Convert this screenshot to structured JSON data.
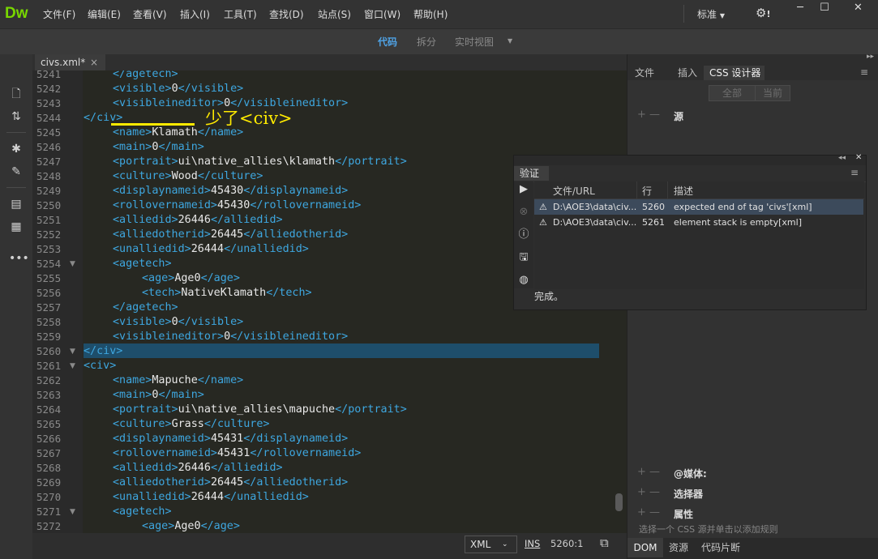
{
  "app": {
    "logo": "Dw"
  },
  "menu": [
    "文件(F)",
    "编辑(E)",
    "查看(V)",
    "插入(I)",
    "工具(T)",
    "查找(D)",
    "站点(S)",
    "窗口(W)",
    "帮助(H)"
  ],
  "workspace_label": "标准",
  "view_tabs": {
    "code": "代码",
    "split": "拆分",
    "live": "实时视图"
  },
  "doc_tab": {
    "label": "civs.xml*",
    "close": "×"
  },
  "line_numbers": [
    "5241",
    "5242",
    "5243",
    "5244",
    "5245",
    "5246",
    "5247",
    "5248",
    "5249",
    "5250",
    "5251",
    "5252",
    "5253",
    "5254",
    "5255",
    "5256",
    "5257",
    "5258",
    "5259",
    "5260",
    "5261",
    "5262",
    "5263",
    "5264",
    "5265",
    "5266",
    "5267",
    "5268",
    "5269",
    "5270",
    "5271",
    "5272"
  ],
  "code_lines": [
    {
      "indent": 2,
      "open": "</agetech>",
      "text": "",
      "close": ""
    },
    {
      "indent": 2,
      "open": "<visible>",
      "text": "0",
      "close": "</visible>"
    },
    {
      "indent": 2,
      "open": "<visibleineditor>",
      "text": "0",
      "close": "</visibleineditor>"
    },
    {
      "indent": 1,
      "open": "</civ>",
      "text": "",
      "close": ""
    },
    {
      "indent": 2,
      "open": "<name>",
      "text": "Klamath",
      "close": "</name>"
    },
    {
      "indent": 2,
      "open": "<main>",
      "text": "0",
      "close": "</main>"
    },
    {
      "indent": 2,
      "open": "<portrait>",
      "text": "ui\\native_allies\\klamath",
      "close": "</portrait>"
    },
    {
      "indent": 2,
      "open": "<culture>",
      "text": "Wood",
      "close": "</culture>"
    },
    {
      "indent": 2,
      "open": "<displaynameid>",
      "text": "45430",
      "close": "</displaynameid>"
    },
    {
      "indent": 2,
      "open": "<rollovernameid>",
      "text": "45430",
      "close": "</rollovernameid>"
    },
    {
      "indent": 2,
      "open": "<alliedid>",
      "text": "26446",
      "close": "</alliedid>"
    },
    {
      "indent": 2,
      "open": "<alliedotherid>",
      "text": "26445",
      "close": "</alliedotherid>"
    },
    {
      "indent": 2,
      "open": "<unalliedid>",
      "text": "26444",
      "close": "</unalliedid>"
    },
    {
      "indent": 2,
      "open": "<agetech>",
      "text": "",
      "close": ""
    },
    {
      "indent": 3,
      "open": "<age>",
      "text": "Age0",
      "close": "</age>"
    },
    {
      "indent": 3,
      "open": "<tech>",
      "text": "NativeKlamath",
      "close": "</tech>"
    },
    {
      "indent": 2,
      "open": "</agetech>",
      "text": "",
      "close": ""
    },
    {
      "indent": 2,
      "open": "<visible>",
      "text": "0",
      "close": "</visible>"
    },
    {
      "indent": 2,
      "open": "<visibleineditor>",
      "text": "0",
      "close": "</visibleineditor>"
    },
    {
      "indent": 1,
      "open": "</civ>",
      "text": "",
      "close": ""
    },
    {
      "indent": 1,
      "open": "<civ>",
      "text": "",
      "close": ""
    },
    {
      "indent": 2,
      "open": "<name>",
      "text": "Mapuche",
      "close": "</name>"
    },
    {
      "indent": 2,
      "open": "<main>",
      "text": "0",
      "close": "</main>"
    },
    {
      "indent": 2,
      "open": "<portrait>",
      "text": "ui\\native_allies\\mapuche",
      "close": "</portrait>"
    },
    {
      "indent": 2,
      "open": "<culture>",
      "text": "Grass",
      "close": "</culture>"
    },
    {
      "indent": 2,
      "open": "<displaynameid>",
      "text": "45431",
      "close": "</displaynameid>"
    },
    {
      "indent": 2,
      "open": "<rollovernameid>",
      "text": "45431",
      "close": "</rollovernameid>"
    },
    {
      "indent": 2,
      "open": "<alliedid>",
      "text": "26446",
      "close": "</alliedid>"
    },
    {
      "indent": 2,
      "open": "<alliedotherid>",
      "text": "26445",
      "close": "</alliedotherid>"
    },
    {
      "indent": 2,
      "open": "<unalliedid>",
      "text": "26444",
      "close": "</unalliedid>"
    },
    {
      "indent": 2,
      "open": "<agetech>",
      "text": "",
      "close": ""
    },
    {
      "indent": 3,
      "open": "<age>",
      "text": "Age0",
      "close": "</age>"
    }
  ],
  "annotation": "少了<civ>",
  "status": {
    "language": "XML",
    "ins": "INS",
    "position": "5260:1"
  },
  "right_panel": {
    "tabs": [
      "文件",
      "插入",
      "CSS 设计器"
    ],
    "buttons": [
      "全部",
      "当前"
    ],
    "sections": [
      "源",
      "@媒体:",
      "选择器",
      "属性"
    ],
    "hint": "选择一个 CSS 源并单击以添加规则",
    "bottom_tabs": [
      "DOM",
      "资源",
      "代码片断"
    ]
  },
  "validation": {
    "tab": "验证",
    "headers": [
      "文件/URL",
      "行",
      "描述"
    ],
    "rows": [
      {
        "file": "D:\\AOE3\\data\\civ...",
        "line": "5260",
        "desc": "expected end of tag 'civs'[xml]"
      },
      {
        "file": "D:\\AOE3\\data\\civ...",
        "line": "5261",
        "desc": "element stack is empty[xml]"
      }
    ],
    "status": "完成。"
  },
  "colors": {
    "tag": "#3ea7e0",
    "annotation": "#ffea00",
    "logo": "#78d700",
    "active_view": "#4fa3e6"
  }
}
